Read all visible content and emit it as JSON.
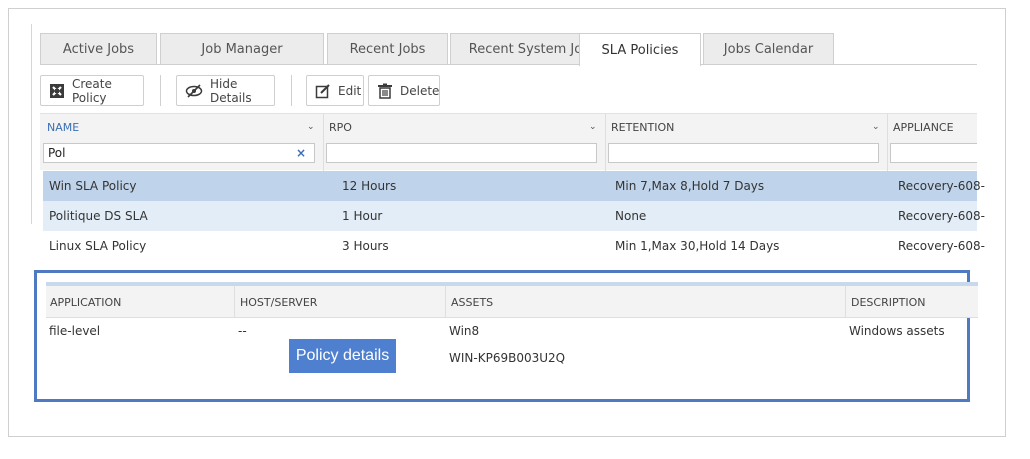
{
  "tabs": [
    {
      "label": "Active Jobs"
    },
    {
      "label": "Job Manager"
    },
    {
      "label": "Recent Jobs"
    },
    {
      "label": "Recent System Jobs"
    },
    {
      "label": "SLA Policies",
      "active": true
    },
    {
      "label": "Jobs Calendar"
    }
  ],
  "toolbar": {
    "create_label": "Create Policy",
    "hide_label": "Hide Details",
    "edit_label": "Edit",
    "delete_label": "Delete"
  },
  "grid": {
    "columns": [
      "NAME",
      "RPO",
      "RETENTION",
      "APPLIANCE"
    ],
    "filter_name_value": "Pol",
    "rows": [
      {
        "name": "Win SLA Policy",
        "rpo": "12 Hours",
        "retention": "Min 7,Max 8,Hold 7 Days",
        "appliance": "Recovery-608-",
        "state": "selected"
      },
      {
        "name": "Politique DS SLA",
        "rpo": "1 Hour",
        "retention": "None",
        "appliance": "Recovery-608-",
        "state": "alt"
      },
      {
        "name": "Linux SLA Policy",
        "rpo": "3 Hours",
        "retention": "Min 1,Max 30,Hold 14 Days",
        "appliance": "Recovery-608-",
        "state": "normal"
      }
    ]
  },
  "details": {
    "columns": [
      "APPLICATION",
      "HOST/SERVER",
      "ASSETS",
      "DESCRIPTION"
    ],
    "application": "file-level",
    "host": "--",
    "assets": [
      "Win8",
      "WIN-KP69B003U2Q"
    ],
    "description": "Windows assets"
  },
  "callout": "Policy details",
  "colors": {
    "accent": "#4f79c3",
    "selected_row": "#bfd4ea",
    "alt_row": "#e3edf7",
    "header_blue": "#3a6fb5"
  }
}
